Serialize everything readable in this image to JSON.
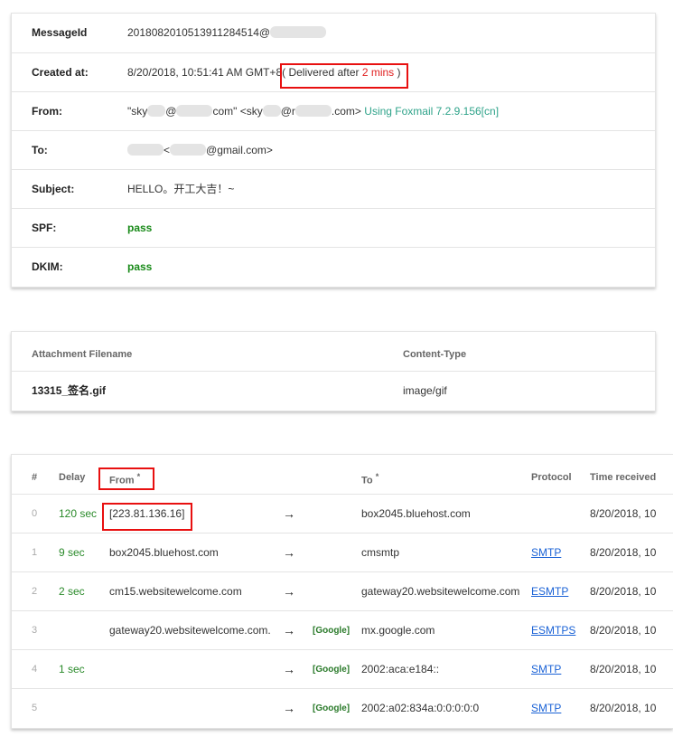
{
  "header": {
    "rows": [
      {
        "label": "MessageId",
        "value": "201808201051391128451​4@"
      },
      {
        "label": "Created at:",
        "value": "8/20/2018, 10:51:41 AM GMT+8",
        "note_prefix": "( Delivered after ",
        "note_delay": "2 mins",
        "note_suffix": " )"
      },
      {
        "label": "From:",
        "value_a": "\"sky",
        "value_b": "@",
        "value_c": "com\" <sky",
        "value_d": "@r",
        "value_e": ".com>",
        "client": "Using Foxmail 7.2.9.156[cn]"
      },
      {
        "label": "To:",
        "value_a": "<",
        "value_b": "@gmail.com>"
      },
      {
        "label": "Subject:",
        "value": "HELLO。开工大吉！~"
      },
      {
        "label": "SPF:",
        "value": "pass"
      },
      {
        "label": "DKIM:",
        "value": "pass"
      }
    ]
  },
  "attachments": {
    "headers": [
      "Attachment Filename",
      "Content-Type"
    ],
    "rows": [
      {
        "filename": "13315_签名.gif",
        "type": "image/gif"
      }
    ]
  },
  "hops": {
    "headers": {
      "index": "#",
      "delay": "Delay",
      "from": "From",
      "from_star": "*",
      "to": "To",
      "to_star": "*",
      "protocol": "Protocol",
      "time": "Time received"
    },
    "arrow": "→",
    "rows": [
      {
        "index": "0",
        "delay": "120 sec",
        "from": "[223.81.136.16]",
        "tag": "",
        "to": "box2045.bluehost.com",
        "protocol": "",
        "time": "8/20/2018, 10"
      },
      {
        "index": "1",
        "delay": "9 sec",
        "from": "box2045.bluehost.com",
        "tag": "",
        "to": "cmsmtp",
        "protocol": "SMTP",
        "time": "8/20/2018, 10"
      },
      {
        "index": "2",
        "delay": "2 sec",
        "from": "cm15.websitewelcome.com",
        "tag": "",
        "to": "gateway20.websitewelcome.com",
        "protocol": "ESMTP",
        "time": "8/20/2018, 10"
      },
      {
        "index": "3",
        "delay": "",
        "from": "gateway20.websitewelcome.com.",
        "tag": "[Google]",
        "to": "mx.google.com",
        "protocol": "ESMTPS",
        "time": "8/20/2018, 10"
      },
      {
        "index": "4",
        "delay": "1 sec",
        "from": "",
        "tag": "[Google]",
        "to": "2002:aca:e184::",
        "protocol": "SMTP",
        "time": "8/20/2018, 10"
      },
      {
        "index": "5",
        "delay": "",
        "from": "",
        "tag": "[Google]",
        "to": "2002:a02:834a:0:0:0:0:0",
        "protocol": "SMTP",
        "time": "8/20/2018, 10"
      }
    ]
  },
  "colors": {
    "accent_red": "#e81010",
    "pass_green": "#188a18",
    "client_teal": "#2fa38a",
    "link_blue": "#1a62d6"
  }
}
